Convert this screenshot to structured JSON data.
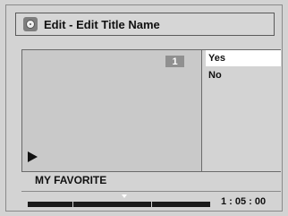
{
  "title": "Edit - Edit Title Name",
  "title_number": "1",
  "menu": {
    "items": [
      {
        "label": "Yes",
        "selected": true
      },
      {
        "label": "No",
        "selected": false
      }
    ]
  },
  "program_name": "MY FAVORITE",
  "time": "1 : 05 : 00",
  "icons": {
    "title_icon": "disc-icon",
    "playback_icon": "play-icon",
    "position_marker": "marker-triangle-icon"
  },
  "colors": {
    "background": "#d3d3d3",
    "selection": "#ffffff",
    "progress_bar": "#1a1a1a",
    "title_number_badge": "#909090"
  }
}
